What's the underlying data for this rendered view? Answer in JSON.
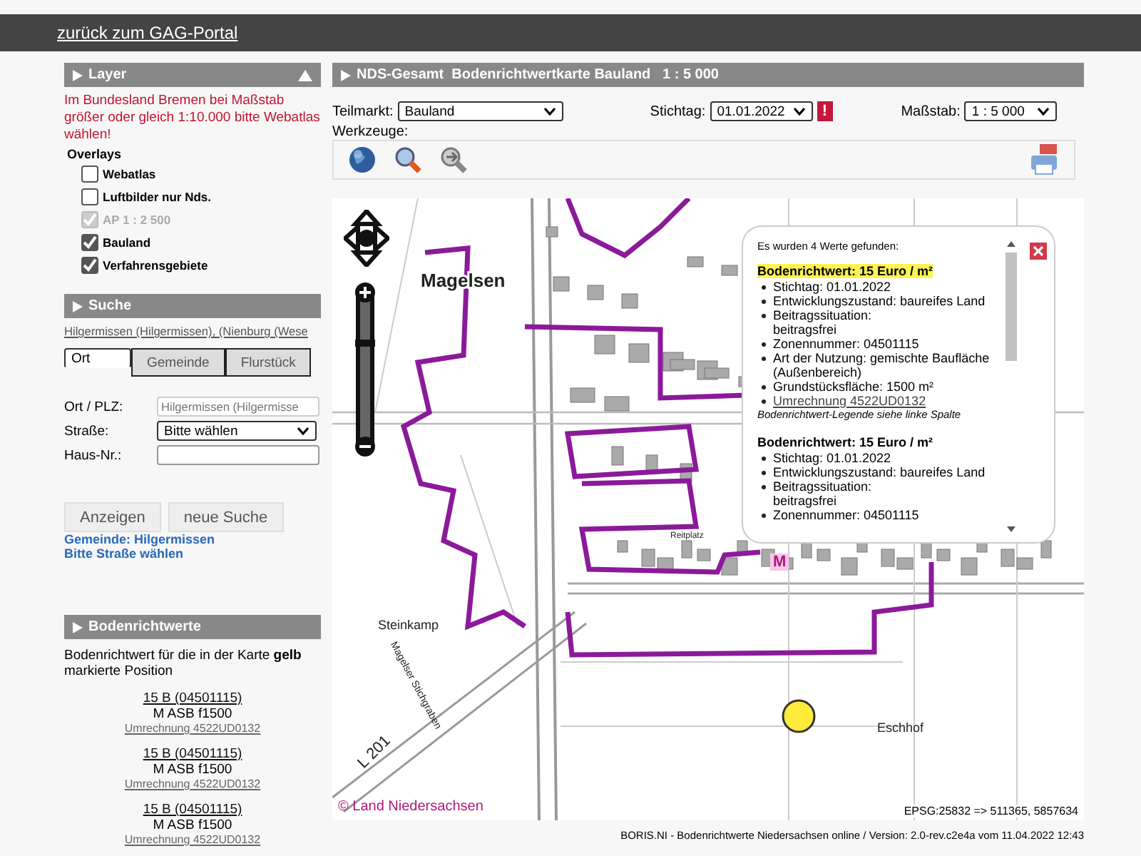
{
  "header": {
    "link": "zurück zum GAG-Portal"
  },
  "layer_panel": {
    "title": "Layer",
    "expanded": true,
    "warning": "Im Bundesland Bremen bei Maßstab größer oder gleich 1:10.000 bitte Webatlas wählen!",
    "overlays_label": "Overlays",
    "overlays": [
      {
        "label": "Webatlas",
        "checked": false,
        "disabled": false
      },
      {
        "label": "Luftbilder nur Nds.",
        "checked": false,
        "disabled": false
      },
      {
        "label": "AP 1 : 2 500",
        "checked": true,
        "disabled": true
      },
      {
        "label": "Bauland",
        "checked": true,
        "disabled": false
      },
      {
        "label": "Verfahrensgebiete",
        "checked": true,
        "disabled": false
      }
    ]
  },
  "search_panel": {
    "title": "Suche",
    "breadcrumb": "Hilgermissen (Hilgermissen), (Nienburg (Wese",
    "tabs": [
      {
        "label": "Ort",
        "selected": true
      },
      {
        "label": "Gemeinde",
        "selected": false
      },
      {
        "label": "Flurstück",
        "selected": false
      }
    ],
    "fields": [
      {
        "kind": "input",
        "label": "Ort / PLZ:",
        "value": "Hilgermissen (Hilgermisse",
        "disabled": true
      },
      {
        "kind": "select",
        "label": "Straße:",
        "value": "Bitte wählen"
      },
      {
        "kind": "input",
        "label": "Haus-Nr.:",
        "disabled": false
      }
    ],
    "buttons": [
      "Anzeigen",
      "neue Suche"
    ],
    "messages": [
      "Gemeinde: Hilgermissen",
      "Bitte Straße wählen"
    ]
  },
  "values_panel": {
    "title": "Bodenrichtwerte",
    "intro": "Bodenrichtwert für die in der Karte **gelb** markierte Position",
    "entries": [
      {
        "zone": "15 B (04501115)",
        "code": "M ASB f1500",
        "link": "Umrechnung 4522UD0132"
      },
      {
        "zone": "15 B (04501115)",
        "code": "M ASB f1500",
        "link": "Umrechnung 4522UD0132"
      },
      {
        "zone": "15 B (04501115)",
        "code": "M ASB f1500",
        "link": "Umrechnung 4522UD0132"
      }
    ]
  },
  "map_panel": {
    "title": "NDS-Gesamt  Bodenrichtwertkarte Bauland   1 : 5 000",
    "teilmarkt": {
      "label": "Teilmarkt:",
      "value": "Bauland"
    },
    "stichtag": {
      "label": "Stichtag:",
      "value": "01.01.2022",
      "alert": "!"
    },
    "massstab": {
      "label": "Maßstab:",
      "value": "1 : 5 000"
    },
    "tools_label": "Werkzeuge:",
    "map": {
      "zoom_slider": {
        "level": 0.7
      },
      "labels": [
        "Magelsen",
        "Reitplatz",
        "Steinkamp",
        "Magelser Stichgraben",
        "L 201",
        "Eschhof"
      ],
      "zone_label": "M",
      "copyright": "© Land Niedersachsen",
      "coordinates": "EPSG:25832 => 511365, 5857634"
    },
    "popup": {
      "header": "Es wurden 4 Werte gefunden:",
      "results": [
        {
          "title": "Bodenrichtwert: 15 Euro / m²",
          "highlighted": true,
          "items": [
            {
              "kind": "text",
              "text": "Stichtag: 01.01.2022"
            },
            {
              "kind": "text",
              "text": "Entwicklungszustand: baureifes Land"
            },
            {
              "kind": "text",
              "text": "Beitragssituation:\nbeitragsfrei"
            },
            {
              "kind": "text",
              "text": "Zonennummer: 04501115"
            },
            {
              "kind": "text",
              "text": "Art der Nutzung: gemischte Baufläche\n(Außenbereich)"
            },
            {
              "kind": "text",
              "text": "Grundstücksfläche: 1500 m²"
            },
            {
              "kind": "link",
              "text": "Umrechnung 4522UD0132"
            }
          ],
          "note": "Bodenrichtwert-Legende siehe linke Spalte"
        },
        {
          "title": "Bodenrichtwert: 15 Euro / m²",
          "highlighted": false,
          "items": [
            {
              "kind": "text",
              "text": "Stichtag: 01.01.2022"
            },
            {
              "kind": "text",
              "text": "Entwicklungszustand: baureifes Land"
            },
            {
              "kind": "text",
              "text": "Beitragssituation:\nbeitragsfrei"
            },
            {
              "kind": "text",
              "text": "Zonennummer: 04501115"
            }
          ]
        }
      ]
    }
  },
  "footer": "BORIS.NI - Bodenrichtwerte Niedersachsen online / Version: 2.0-rev.c2e4a vom 11.04.2022 12:43"
}
